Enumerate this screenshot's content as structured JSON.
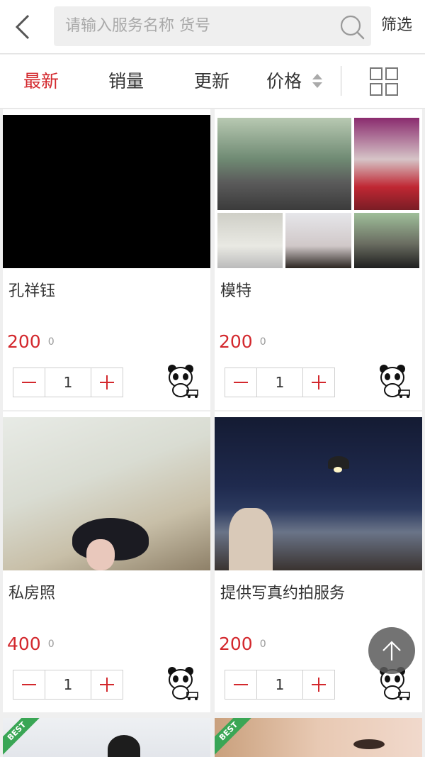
{
  "header": {
    "search_placeholder": "请输入服务名称 货号",
    "filter_label": "筛选"
  },
  "sort": {
    "tabs": [
      "最新",
      "销量",
      "更新",
      "价格"
    ],
    "active_index": 0
  },
  "products": [
    {
      "title": "孔祥钰",
      "price": "200",
      "stock": "0",
      "qty": "1"
    },
    {
      "title": "模特",
      "price": "200",
      "stock": "0",
      "qty": "1"
    },
    {
      "title": "私房照",
      "price": "400",
      "stock": "0",
      "qty": "1"
    },
    {
      "title": "提供写真约拍服务",
      "price": "200",
      "stock": "0",
      "qty": "1"
    }
  ],
  "partial_cards": [
    {
      "badge": "BEST"
    },
    {
      "badge": "BEST"
    }
  ],
  "colors": {
    "accent": "#d3282d",
    "badge": "#3aa655"
  }
}
